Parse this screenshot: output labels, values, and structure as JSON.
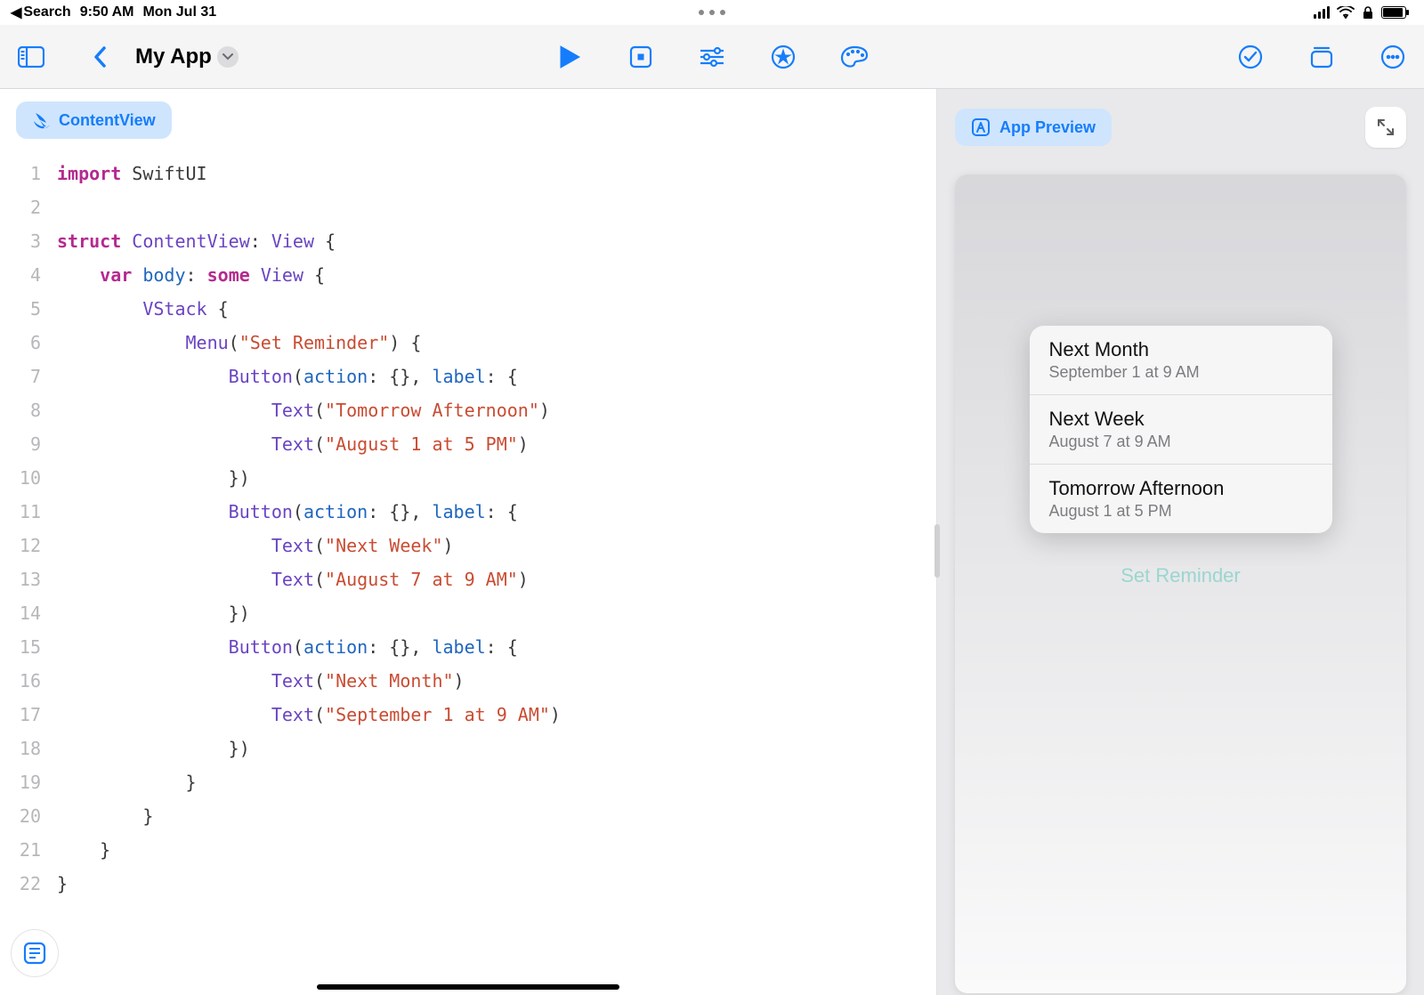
{
  "status_bar": {
    "back_label": "Search",
    "time": "9:50 AM",
    "date": "Mon Jul 31"
  },
  "toolbar": {
    "title": "My App"
  },
  "editor": {
    "file_chip": "ContentView",
    "line_count": 22,
    "code_lines": [
      [
        [
          "kw",
          "import"
        ],
        [
          "plain",
          " SwiftUI"
        ]
      ],
      [
        [
          "plain",
          ""
        ]
      ],
      [
        [
          "kw",
          "struct"
        ],
        [
          "plain",
          " "
        ],
        [
          "type",
          "ContentView"
        ],
        [
          "plain",
          ": "
        ],
        [
          "type",
          "View"
        ],
        [
          "plain",
          " {"
        ]
      ],
      [
        [
          "plain",
          "    "
        ],
        [
          "kw",
          "var"
        ],
        [
          "plain",
          " "
        ],
        [
          "id",
          "body"
        ],
        [
          "plain",
          ": "
        ],
        [
          "kw",
          "some"
        ],
        [
          "plain",
          " "
        ],
        [
          "type",
          "View"
        ],
        [
          "plain",
          " {"
        ]
      ],
      [
        [
          "plain",
          "        "
        ],
        [
          "type",
          "VStack"
        ],
        [
          "plain",
          " {"
        ]
      ],
      [
        [
          "plain",
          "            "
        ],
        [
          "type",
          "Menu"
        ],
        [
          "plain",
          "("
        ],
        [
          "str",
          "\"Set Reminder\""
        ],
        [
          "plain",
          ") {"
        ]
      ],
      [
        [
          "plain",
          "                "
        ],
        [
          "type",
          "Button"
        ],
        [
          "plain",
          "("
        ],
        [
          "id",
          "action"
        ],
        [
          "plain",
          ": {}, "
        ],
        [
          "id",
          "label"
        ],
        [
          "plain",
          ": {"
        ]
      ],
      [
        [
          "plain",
          "                    "
        ],
        [
          "type",
          "Text"
        ],
        [
          "plain",
          "("
        ],
        [
          "str",
          "\"Tomorrow Afternoon\""
        ],
        [
          "plain",
          ")"
        ]
      ],
      [
        [
          "plain",
          "                    "
        ],
        [
          "type",
          "Text"
        ],
        [
          "plain",
          "("
        ],
        [
          "str",
          "\"August 1 at 5 PM\""
        ],
        [
          "plain",
          ")"
        ]
      ],
      [
        [
          "plain",
          "                })"
        ]
      ],
      [
        [
          "plain",
          "                "
        ],
        [
          "type",
          "Button"
        ],
        [
          "plain",
          "("
        ],
        [
          "id",
          "action"
        ],
        [
          "plain",
          ": {}, "
        ],
        [
          "id",
          "label"
        ],
        [
          "plain",
          ": {"
        ]
      ],
      [
        [
          "plain",
          "                    "
        ],
        [
          "type",
          "Text"
        ],
        [
          "plain",
          "("
        ],
        [
          "str",
          "\"Next Week\""
        ],
        [
          "plain",
          ")"
        ]
      ],
      [
        [
          "plain",
          "                    "
        ],
        [
          "type",
          "Text"
        ],
        [
          "plain",
          "("
        ],
        [
          "str",
          "\"August 7 at 9 AM\""
        ],
        [
          "plain",
          ")"
        ]
      ],
      [
        [
          "plain",
          "                })"
        ]
      ],
      [
        [
          "plain",
          "                "
        ],
        [
          "type",
          "Button"
        ],
        [
          "plain",
          "("
        ],
        [
          "id",
          "action"
        ],
        [
          "plain",
          ": {}, "
        ],
        [
          "id",
          "label"
        ],
        [
          "plain",
          ": {"
        ]
      ],
      [
        [
          "plain",
          "                    "
        ],
        [
          "type",
          "Text"
        ],
        [
          "plain",
          "("
        ],
        [
          "str",
          "\"Next Month\""
        ],
        [
          "plain",
          ")"
        ]
      ],
      [
        [
          "plain",
          "                    "
        ],
        [
          "type",
          "Text"
        ],
        [
          "plain",
          "("
        ],
        [
          "str",
          "\"September 1 at 9 AM\""
        ],
        [
          "plain",
          ")"
        ]
      ],
      [
        [
          "plain",
          "                })"
        ]
      ],
      [
        [
          "plain",
          "            }"
        ]
      ],
      [
        [
          "plain",
          "        }"
        ]
      ],
      [
        [
          "plain",
          "    }"
        ]
      ],
      [
        [
          "plain",
          "}"
        ]
      ]
    ]
  },
  "preview": {
    "badge": "App Preview",
    "menu_trigger_label": "Set Reminder",
    "menu_items": [
      {
        "title": "Next Month",
        "subtitle": "September 1 at 9 AM"
      },
      {
        "title": "Next Week",
        "subtitle": "August 7 at 9 AM"
      },
      {
        "title": "Tomorrow Afternoon",
        "subtitle": "August 1 at 5 PM"
      }
    ]
  }
}
